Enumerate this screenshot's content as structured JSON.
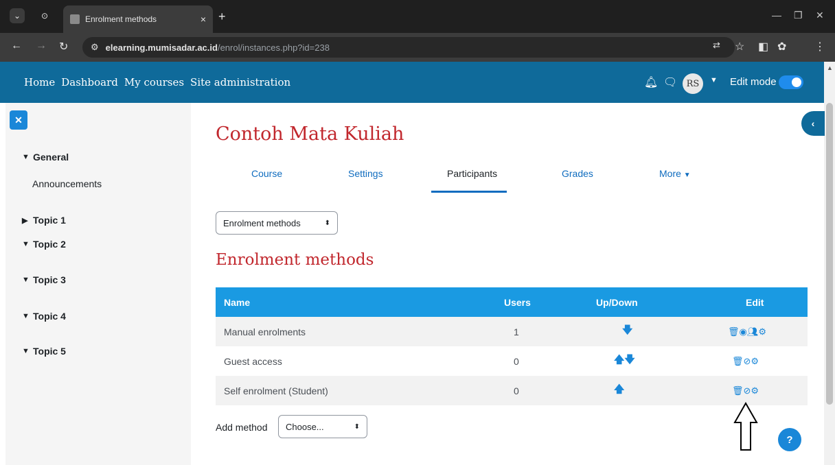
{
  "browser": {
    "tab_title": "Enrolment methods",
    "url_host": "elearning.mumisadar.ac.id",
    "url_path": "/enrol/instances.php?id=238"
  },
  "navbar": {
    "links": [
      "Home",
      "Dashboard",
      "My courses",
      "Site administration"
    ],
    "avatar_initials": "RS",
    "edit_mode_label": "Edit mode",
    "edit_mode_on": true
  },
  "sidebar": {
    "sections": [
      {
        "label": "General",
        "expanded": true,
        "children": [
          "Announcements"
        ]
      },
      {
        "label": "Topic 1",
        "expanded": false,
        "children": []
      },
      {
        "label": "Topic 2",
        "expanded": true,
        "children": []
      },
      {
        "label": "Topic 3",
        "expanded": true,
        "children": []
      },
      {
        "label": "Topic 4",
        "expanded": true,
        "children": []
      },
      {
        "label": "Topic 5",
        "expanded": true,
        "children": []
      }
    ]
  },
  "main": {
    "course_title": "Contoh Mata Kuliah",
    "tabs": [
      "Course",
      "Settings",
      "Participants",
      "Grades",
      "More"
    ],
    "active_tab": "Participants",
    "page_select": "Enrolment methods",
    "section_title": "Enrolment methods",
    "table": {
      "headers": [
        "Name",
        "Users",
        "Up/Down",
        "Edit"
      ],
      "rows": [
        {
          "name": "Manual enrolments",
          "users": "1",
          "updown": [
            "down"
          ],
          "edit": [
            "delete-icon",
            "show-icon",
            "enrol-users-icon",
            "settings-icon"
          ]
        },
        {
          "name": "Guest access",
          "users": "0",
          "updown": [
            "up",
            "down"
          ],
          "edit": [
            "delete-icon",
            "hide-icon",
            "settings-icon"
          ]
        },
        {
          "name": "Self enrolment (Student)",
          "users": "0",
          "updown": [
            "up"
          ],
          "edit": [
            "delete-icon",
            "hide-icon",
            "settings-icon"
          ]
        }
      ]
    },
    "add_method_label": "Add method",
    "add_method_select": "Choose..."
  },
  "help_button": "?",
  "colors": {
    "navbar": "#0f6a9a",
    "title_red": "#c1272d",
    "table_header": "#1a9ae2",
    "link_blue": "#0f6cbf"
  }
}
